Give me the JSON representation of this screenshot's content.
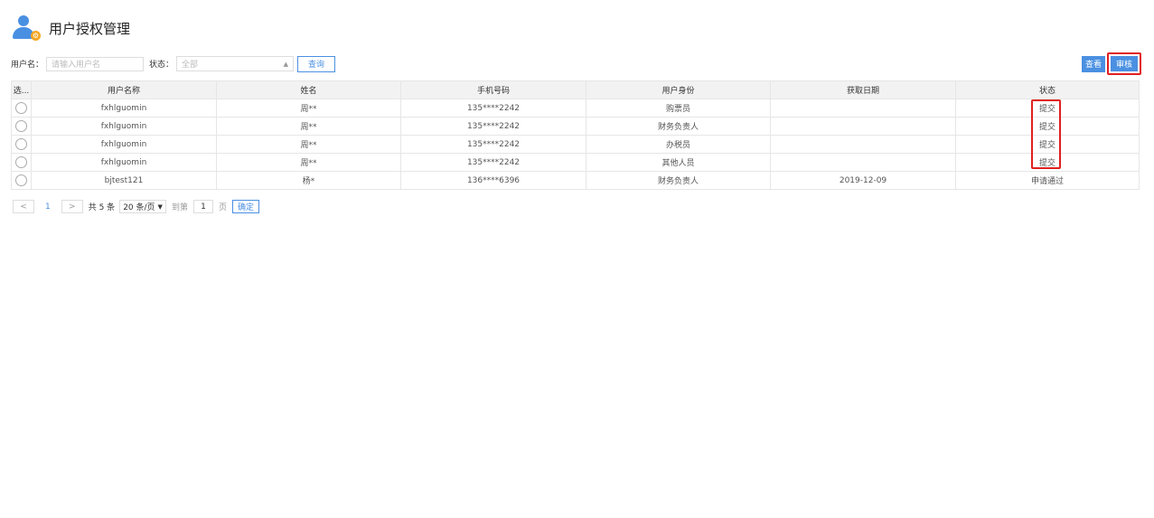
{
  "header": {
    "title": "用户授权管理",
    "icon": "user-settings-icon"
  },
  "search": {
    "username_label": "用户名：",
    "username_placeholder": "请输入用户名",
    "status_label": "状态：",
    "status_value": "全部",
    "query_button": "查询"
  },
  "actions": {
    "view": "查看",
    "audit": "审核"
  },
  "table": {
    "columns": [
      "选...",
      "用户名称",
      "姓名",
      "手机号码",
      "用户身份",
      "获取日期",
      "状态"
    ],
    "rows": [
      {
        "username": "fxhlguomin",
        "name": "周**",
        "phone": "135****2242",
        "identity": "购票员",
        "date": "",
        "status": "提交"
      },
      {
        "username": "fxhlguomin",
        "name": "周**",
        "phone": "135****2242",
        "identity": "财务负责人",
        "date": "",
        "status": "提交"
      },
      {
        "username": "fxhlguomin",
        "name": "周**",
        "phone": "135****2242",
        "identity": "办税员",
        "date": "",
        "status": "提交"
      },
      {
        "username": "fxhlguomin",
        "name": "周**",
        "phone": "135****2242",
        "identity": "其他人员",
        "date": "",
        "status": "提交"
      },
      {
        "username": "bjtest121",
        "name": "杨*",
        "phone": "136****6396",
        "identity": "财务负责人",
        "date": "2019-12-09",
        "status": "申请通过"
      }
    ]
  },
  "pager": {
    "prev": "<",
    "current_page": "1",
    "next": ">",
    "total_text": "共 5 条",
    "page_size": "20 条/页",
    "goto_label": "到第",
    "goto_value": "1",
    "page_unit": "页",
    "confirm": "确定"
  },
  "colors": {
    "accent": "#4a90e2",
    "highlight": "#e02020"
  }
}
